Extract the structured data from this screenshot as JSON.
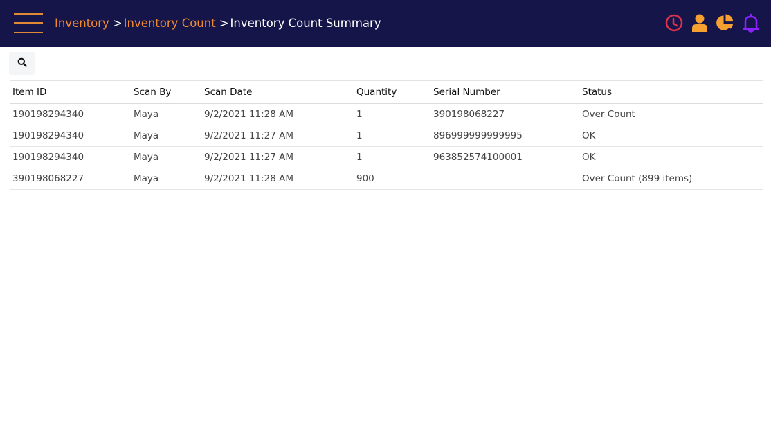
{
  "header": {
    "menu_icon": "hamburger-menu-icon",
    "breadcrumb": [
      {
        "label": "Inventory",
        "link": true
      },
      {
        "label": "Inventory Count",
        "link": true
      },
      {
        "label": "Inventory Count Summary",
        "link": false
      }
    ],
    "separator": ">",
    "icons": [
      {
        "name": "clock-icon",
        "color": "#e0304a"
      },
      {
        "name": "user-icon",
        "color": "#f5a030"
      },
      {
        "name": "pie-chart-icon",
        "color": "#f5a030"
      },
      {
        "name": "bell-icon",
        "color": "#8a22ff"
      }
    ]
  },
  "toolbar": {
    "search_icon": "search-icon"
  },
  "table": {
    "columns": [
      "Item ID",
      "Scan By",
      "Scan Date",
      "Quantity",
      "Serial Number",
      "Status"
    ],
    "rows": [
      [
        "190198294340",
        "Maya",
        "9/2/2021 11:28 AM",
        "1",
        "390198068227",
        "Over Count"
      ],
      [
        "190198294340",
        "Maya",
        "9/2/2021 11:27 AM",
        "1",
        "896999999999995",
        "OK"
      ],
      [
        "190198294340",
        "Maya",
        "9/2/2021 11:27 AM",
        "1",
        "963852574100001",
        "OK"
      ],
      [
        "390198068227",
        "Maya",
        "9/2/2021 11:28 AM",
        "900",
        "",
        "Over Count (899 items)"
      ]
    ]
  },
  "colors": {
    "topbar": "#15154a",
    "accent": "#f08a30"
  }
}
